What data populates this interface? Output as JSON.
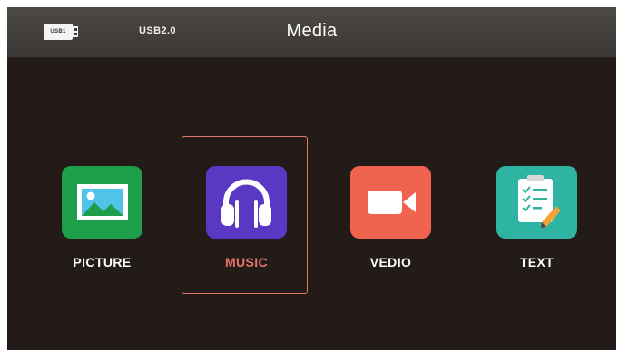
{
  "header": {
    "usb_icon_text": "USB1",
    "usb_label": "USB2.0",
    "title": "Media"
  },
  "tiles": [
    {
      "label": "PICTURE",
      "icon": "picture-icon",
      "color": "#1e9e4a"
    },
    {
      "label": "MUSIC",
      "icon": "headphones-icon",
      "color": "#5a38c4",
      "selected": true
    },
    {
      "label": "VEDIO",
      "icon": "video-camera-icon",
      "color": "#f0634f"
    },
    {
      "label": "TEXT",
      "icon": "text-document-icon",
      "color": "#2fb3a2"
    }
  ],
  "colors": {
    "background": "#231b18",
    "selected_label": "#e8756a",
    "focus_border": "#e27668"
  }
}
